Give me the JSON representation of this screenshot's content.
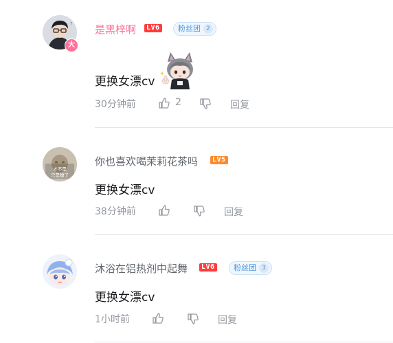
{
  "comments": [
    {
      "username": "是黑梓啊",
      "username_vip": true,
      "level": "LV6",
      "fans_label": "粉丝团",
      "fans_count": "2",
      "vip_badge": "大",
      "content": "更换女漂cv",
      "has_sticker": true,
      "time": "30分钟前",
      "likes": "2",
      "reply_label": "回复"
    },
    {
      "username": "你也喜欢喝茉莉花茶吗",
      "username_vip": false,
      "level": "LV5",
      "avatar_text_line1": "才不是",
      "avatar_text_line2": "只是睡了",
      "content": "更换女漂cv",
      "time": "38分钟前",
      "likes": "",
      "reply_label": "回复"
    },
    {
      "username": "沐浴在铝热剂中起舞",
      "username_vip": false,
      "level": "LV6",
      "fans_label": "粉丝团",
      "fans_count": "3",
      "content": "更换女漂cv",
      "time": "1小时前",
      "likes": "",
      "reply_label": "回复"
    }
  ],
  "colors": {
    "vip_name": "#fb7299",
    "name": "#61666d",
    "text": "#18191c",
    "meta": "#9499a0",
    "divider": "#e3e5e7",
    "level6": "#ff3b3b",
    "level5": "#ff8a2a"
  },
  "icons": [
    "thumb-up-icon",
    "thumb-down-icon"
  ]
}
